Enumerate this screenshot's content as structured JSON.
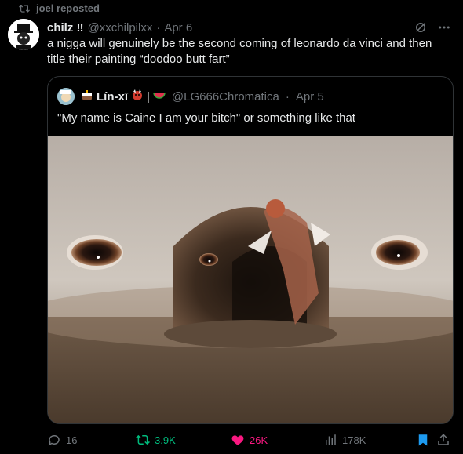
{
  "repost": {
    "label": "joel reposted"
  },
  "tweet": {
    "name": "chilz ‼",
    "handle": "@xxchilpilxx",
    "dot": "·",
    "date": "Apr 6",
    "text": "a nigga will genuinely be the second coming of leonardo da vinci and then title their painting “doodoo butt fart”"
  },
  "quote": {
    "name": "Lín-xī",
    "handle": "@LG666Chromatica",
    "dot": "·",
    "date": "Apr 5",
    "text": "\"My name is Caine I am your bitch\" or something like that"
  },
  "actions": {
    "replies": "16",
    "reposts": "3.9K",
    "likes": "26K",
    "views": "178K"
  },
  "colors": {
    "repost_active": "#00ba7c",
    "like_active": "#f91880",
    "bookmark_active": "#1d9bf0",
    "muted": "#71767b"
  },
  "icons": [
    "repost-icon",
    "grok-icon",
    "more-icon",
    "reply-icon",
    "like-icon",
    "views-icon",
    "bookmark-icon",
    "share-icon"
  ]
}
